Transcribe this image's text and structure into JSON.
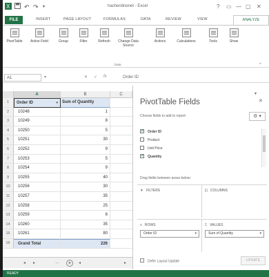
{
  "window": {
    "title": "hacherdinenet - Excel",
    "controls": [
      "?",
      "▭",
      "—",
      "▢",
      "✕"
    ]
  },
  "ribbon_tabs": [
    {
      "key": "file",
      "label": "FILE"
    },
    {
      "key": "insert",
      "label": "INSERT"
    },
    {
      "key": "page_layout",
      "label": "PAGE LAYOUT"
    },
    {
      "key": "formulas",
      "label": "FORMULAS"
    },
    {
      "key": "data",
      "label": "DATA"
    },
    {
      "key": "review",
      "label": "REVIEW"
    },
    {
      "key": "view",
      "label": "VIEW"
    },
    {
      "key": "analyze",
      "label": "ANALYZE"
    }
  ],
  "ribbon": {
    "buttons": [
      {
        "label": "PivotTable"
      },
      {
        "label": "Active Field"
      },
      {
        "label": "Group"
      },
      {
        "label": "Filter"
      },
      {
        "label": "Refresh"
      },
      {
        "label": "Change Data Source"
      },
      {
        "label": "Actions"
      },
      {
        "label": "Calculations"
      },
      {
        "label": "Tools"
      },
      {
        "label": "Show"
      }
    ],
    "group_label": "Data"
  },
  "formula_bar": {
    "cell_ref": "A1",
    "formula": "Order ID"
  },
  "sheet": {
    "columns": [
      "A",
      "B",
      "C"
    ],
    "header": {
      "row": "1",
      "a": "Order ID",
      "b": "Sum of Quantity"
    },
    "rows": [
      {
        "row": "2",
        "a": "10248",
        "b": "1"
      },
      {
        "row": "3",
        "a": "10249",
        "b": "8"
      },
      {
        "row": "4",
        "a": "10250",
        "b": "5"
      },
      {
        "row": "5",
        "a": "10251",
        "b": "30"
      },
      {
        "row": "6",
        "a": "10252",
        "b": "9"
      },
      {
        "row": "7",
        "a": "10253",
        "b": "5"
      },
      {
        "row": "8",
        "a": "10254",
        "b": "9"
      },
      {
        "row": "9",
        "a": "10255",
        "b": "40"
      },
      {
        "row": "10",
        "a": "10256",
        "b": "30"
      },
      {
        "row": "11",
        "a": "10257",
        "b": "35"
      },
      {
        "row": "12",
        "a": "10258",
        "b": "25"
      },
      {
        "row": "13",
        "a": "10259",
        "b": "6"
      },
      {
        "row": "14",
        "a": "10260",
        "b": "35"
      },
      {
        "row": "15",
        "a": "10261",
        "b": "80"
      }
    ],
    "total": {
      "row": "16",
      "a": "Grand Total",
      "b": "226"
    }
  },
  "pivot_pane": {
    "title": "PivotTable Fields",
    "subtitle": "Choose fields to add to report:",
    "fields": [
      {
        "label": "Order ID",
        "checked": true
      },
      {
        "label": "Product",
        "checked": false
      },
      {
        "label": "Unit Price",
        "checked": false
      },
      {
        "label": "Quantity",
        "checked": true
      }
    ],
    "drag_label": "Drag fields between areas below:",
    "areas": {
      "filters": {
        "title": "FILTERS",
        "icon": "▼"
      },
      "columns": {
        "title": "COLUMNS",
        "icon": "|||"
      },
      "rows": {
        "title": "ROWS",
        "icon": "≡",
        "item": "Order ID"
      },
      "values": {
        "title": "VALUES",
        "icon": "Σ",
        "item": "Sum of Quantity"
      }
    },
    "defer_label": "Defer Layout Update",
    "update_label": "UPDATE"
  },
  "status": {
    "ready": "READY"
  },
  "colors": {
    "excel_green": "#217346",
    "pivot_header": "#dde6f3"
  }
}
